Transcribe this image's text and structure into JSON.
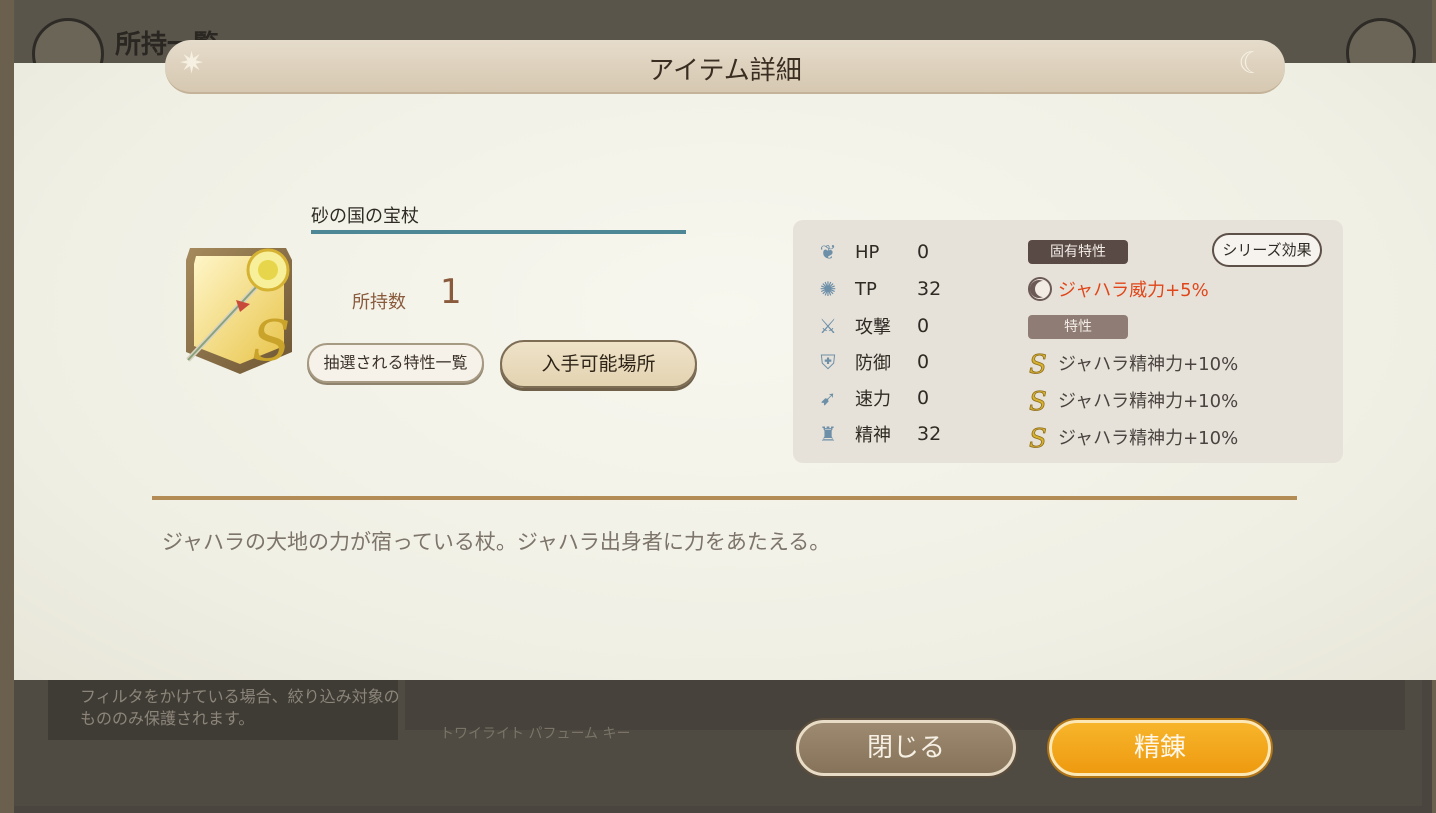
{
  "background": {
    "title": "所持一覧",
    "note": "フィルタをかけている場合、絞り込み対象のもののみ保護されます。",
    "items_label": "トワイライト  パフューム  キー"
  },
  "modal": {
    "title": "アイテム詳細",
    "item": {
      "name": "砂の国の宝杖",
      "owned_label": "所持数",
      "owned_value": "1",
      "traits_button": "抽選される特性一覧",
      "where_button": "入手可能場所"
    },
    "stats": [
      {
        "icon": "hp-icon",
        "label": "HP",
        "value": "0"
      },
      {
        "icon": "tp-icon",
        "label": "TP",
        "value": "32"
      },
      {
        "icon": "attack-icon",
        "label": "攻撃",
        "value": "0"
      },
      {
        "icon": "defense-icon",
        "label": "防御",
        "value": "0"
      },
      {
        "icon": "speed-icon",
        "label": "速力",
        "value": "0"
      },
      {
        "icon": "spirit-icon",
        "label": "精神",
        "value": "32"
      }
    ],
    "unique_trait_badge": "固有特性",
    "series_button": "シリーズ効果",
    "unique_trait": "ジャハラ威力+5%",
    "traits_badge": "特性",
    "traits": [
      "ジャハラ精神力+10%",
      "ジャハラ精神力+10%",
      "ジャハラ精神力+10%"
    ],
    "description": "ジャハラの大地の力が宿っている杖。ジャハラ出身者に力をあたえる。"
  },
  "footer": {
    "close_label": "閉じる",
    "refine_label": "精錬"
  },
  "colors": {
    "accent_orange": "#ee9a10",
    "unique_trait_red": "#e0461a",
    "divider_gold": "#b38b55",
    "name_underline": "#4d8796"
  }
}
